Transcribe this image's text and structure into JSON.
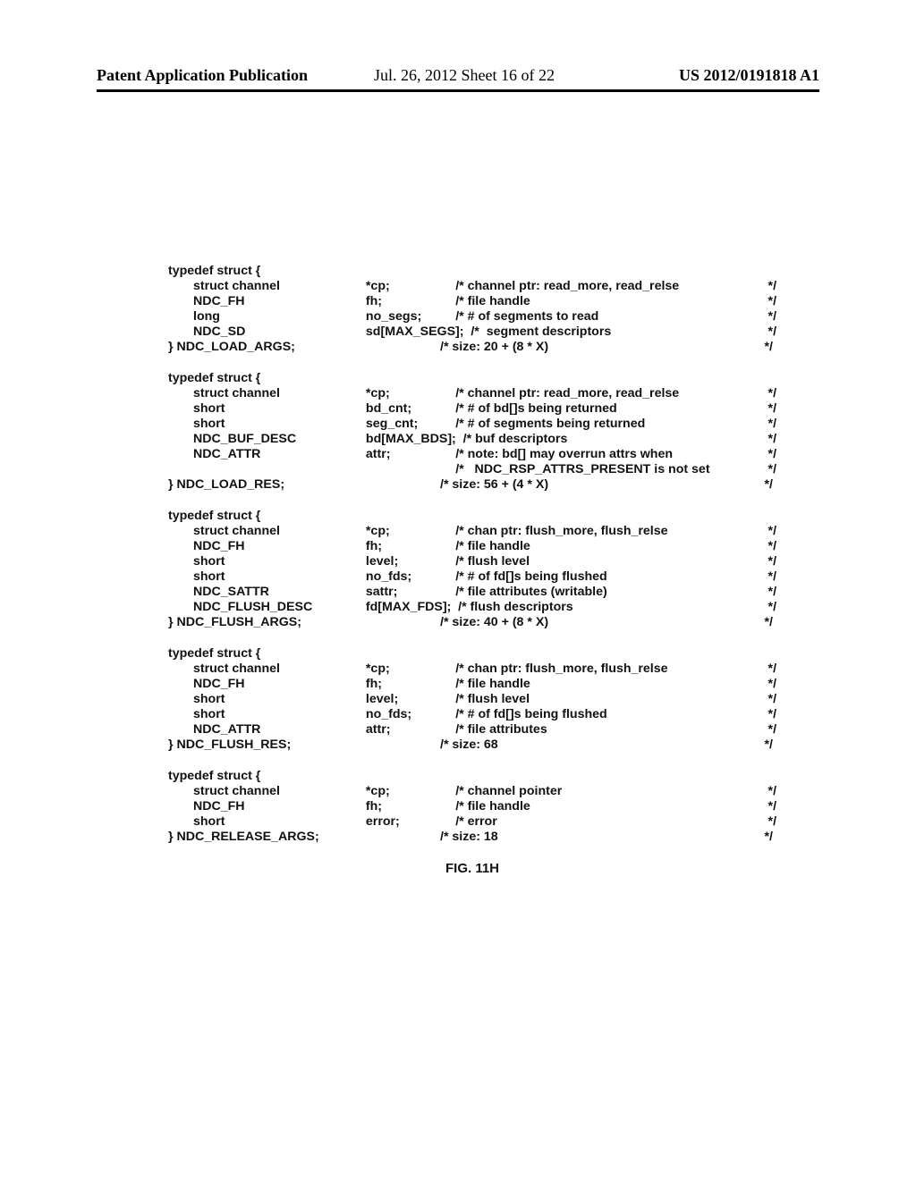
{
  "header": {
    "left": "Patent Application Publication",
    "center": "Jul. 26, 2012  Sheet 16 of 22",
    "right": "US 2012/0191818 A1"
  },
  "figure_caption": "FIG. 11H",
  "structs": [
    {
      "open": "typedef struct {",
      "rows": [
        {
          "type": "struct channel",
          "name": "*cp;",
          "comment": "/* channel ptr: read_more, read_relse",
          "end": "*/"
        },
        {
          "type": "NDC_FH",
          "name": "fh;",
          "comment": "/* file handle",
          "end": "*/"
        },
        {
          "type": "long",
          "name": "no_segs;",
          "comment": "/* # of segments to read",
          "end": "*/"
        },
        {
          "type": "NDC_SD",
          "name": "",
          "comment": "sd[MAX_SEGS];  /*  segment descriptors",
          "end": "*/",
          "name_merge": true
        }
      ],
      "close_type": "} NDC_LOAD_ARGS;",
      "close_comment": "/* size: 20 + (8 * X)",
      "close_end": "*/"
    },
    {
      "open": "typedef struct {",
      "rows": [
        {
          "type": "struct channel",
          "name": "*cp;",
          "comment": "/* channel ptr: read_more, read_relse",
          "end": "*/"
        },
        {
          "type": "short",
          "name": "bd_cnt;",
          "comment": "/* # of bd[]s being returned",
          "end": "*/"
        },
        {
          "type": "short",
          "name": "seg_cnt;",
          "comment": "/* # of segments being returned",
          "end": "*/"
        },
        {
          "type": "NDC_BUF_DESC",
          "name": "",
          "comment": "bd[MAX_BDS];  /* buf descriptors",
          "end": "*/",
          "name_merge": true
        },
        {
          "type": "NDC_ATTR",
          "name": "attr;",
          "comment": "/* note: bd[] may overrun attrs when",
          "end": "*/"
        },
        {
          "type": "",
          "name": "",
          "comment": "/*   NDC_RSP_ATTRS_PRESENT is not set",
          "end": "*/"
        }
      ],
      "close_type": "} NDC_LOAD_RES;",
      "close_comment": "/* size: 56 + (4 * X)",
      "close_end": "*/"
    },
    {
      "open": "typedef struct {",
      "rows": [
        {
          "type": "struct channel",
          "name": "*cp;",
          "comment": "/* chan ptr: flush_more, flush_relse",
          "end": "*/"
        },
        {
          "type": "NDC_FH",
          "name": "fh;",
          "comment": "/* file handle",
          "end": "*/"
        },
        {
          "type": "short",
          "name": "level;",
          "comment": "/* flush level",
          "end": "*/"
        },
        {
          "type": "short",
          "name": "no_fds;",
          "comment": "/* # of fd[]s being flushed",
          "end": "*/"
        },
        {
          "type": "NDC_SATTR",
          "name": "sattr;",
          "comment": "/* file attributes (writable)",
          "end": "*/"
        },
        {
          "type": "NDC_FLUSH_DESC",
          "name": "",
          "comment": "fd[MAX_FDS];  /* flush descriptors",
          "end": "*/",
          "name_merge": true
        }
      ],
      "close_type": "} NDC_FLUSH_ARGS;",
      "close_comment": "/* size: 40 + (8 * X)",
      "close_end": "*/"
    },
    {
      "open": "typedef struct {",
      "rows": [
        {
          "type": "struct channel",
          "name": "*cp;",
          "comment": "/* chan ptr: flush_more, flush_relse",
          "end": "*/"
        },
        {
          "type": "NDC_FH",
          "name": "fh;",
          "comment": "/* file handle",
          "end": "*/"
        },
        {
          "type": "short",
          "name": "level;",
          "comment": "/* flush level",
          "end": "*/"
        },
        {
          "type": "short",
          "name": "no_fds;",
          "comment": "/* # of fd[]s being flushed",
          "end": "*/"
        },
        {
          "type": "NDC_ATTR",
          "name": "attr;",
          "comment": "/* file attributes",
          "end": "*/"
        }
      ],
      "close_type": "} NDC_FLUSH_RES;",
      "close_comment": "/* size: 68",
      "close_end": "*/"
    },
    {
      "open": "typedef struct {",
      "rows": [
        {
          "type": "struct channel",
          "name": "*cp;",
          "comment": "/* channel pointer",
          "end": "*/"
        },
        {
          "type": "NDC_FH",
          "name": "fh;",
          "comment": "/* file handle",
          "end": "*/"
        },
        {
          "type": "short",
          "name": "error;",
          "comment": "/* error",
          "end": "*/"
        }
      ],
      "close_type": "} NDC_RELEASE_ARGS;",
      "close_comment": "/* size: 18",
      "close_end": "*/"
    }
  ]
}
